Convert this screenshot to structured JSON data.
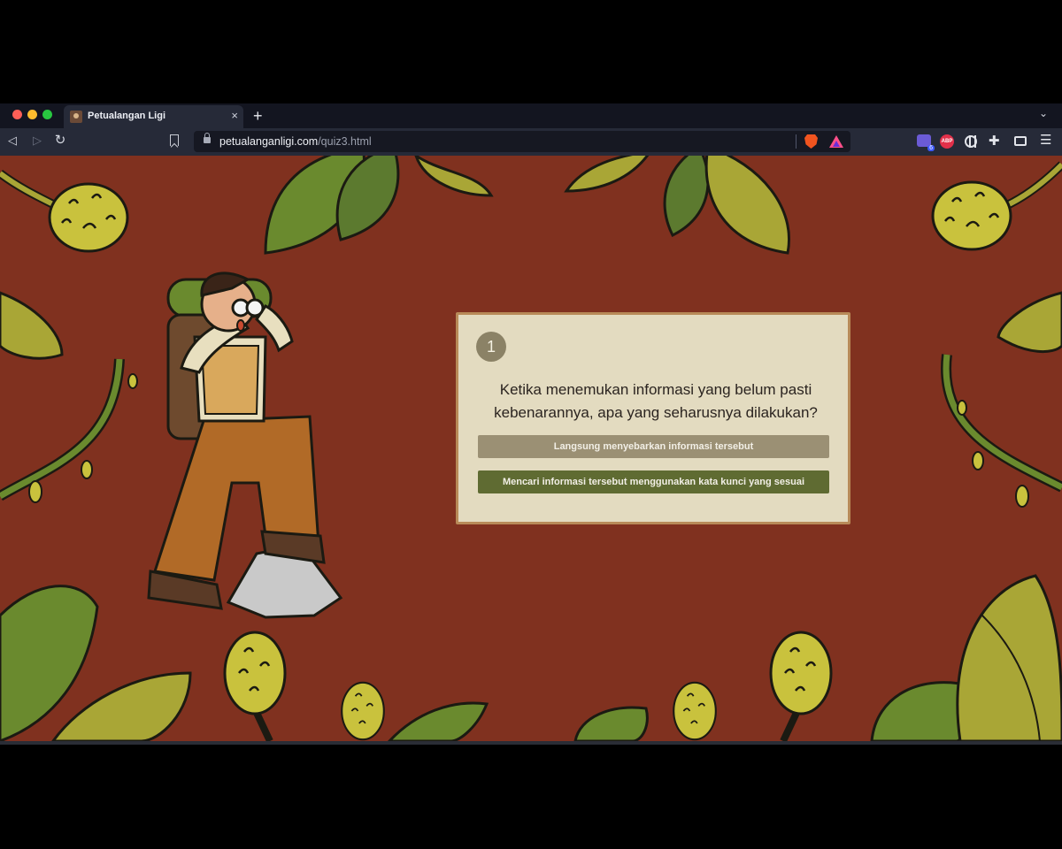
{
  "browser": {
    "tab": {
      "title": "Petualangan Ligi",
      "close_glyph": "×"
    },
    "new_tab_glyph": "+",
    "url": {
      "host": "petualanganligi.com",
      "path": "/quiz3.html"
    },
    "extensions": {
      "notification_badge": "6",
      "abp_label": "ABP"
    },
    "icons": [
      "back-arrow-icon",
      "forward-arrow-icon",
      "reload-icon",
      "bookmark-icon",
      "lock-icon",
      "brave-shields-icon",
      "brave-rewards-icon",
      "puzzle-icon",
      "wallet-icon",
      "hamburger-menu-icon"
    ]
  },
  "quiz": {
    "number": "1",
    "question": "Ketika menemukan informasi yang belum pasti kebenarannya, apa yang seharusnya dilakukan?",
    "options": [
      "Langsung menyebarkan informasi tersebut",
      "Mencari informasi tersebut menggunakan kata kunci yang sesuai"
    ]
  },
  "colors": {
    "page_background": "#80311f",
    "card_background": "#e3dbc0",
    "card_border": "#b88a58",
    "option_neutral": "#9b9074",
    "option_green": "#5f6b32",
    "leaf_dark": "#5c7a2f",
    "leaf_light": "#a9a636"
  }
}
